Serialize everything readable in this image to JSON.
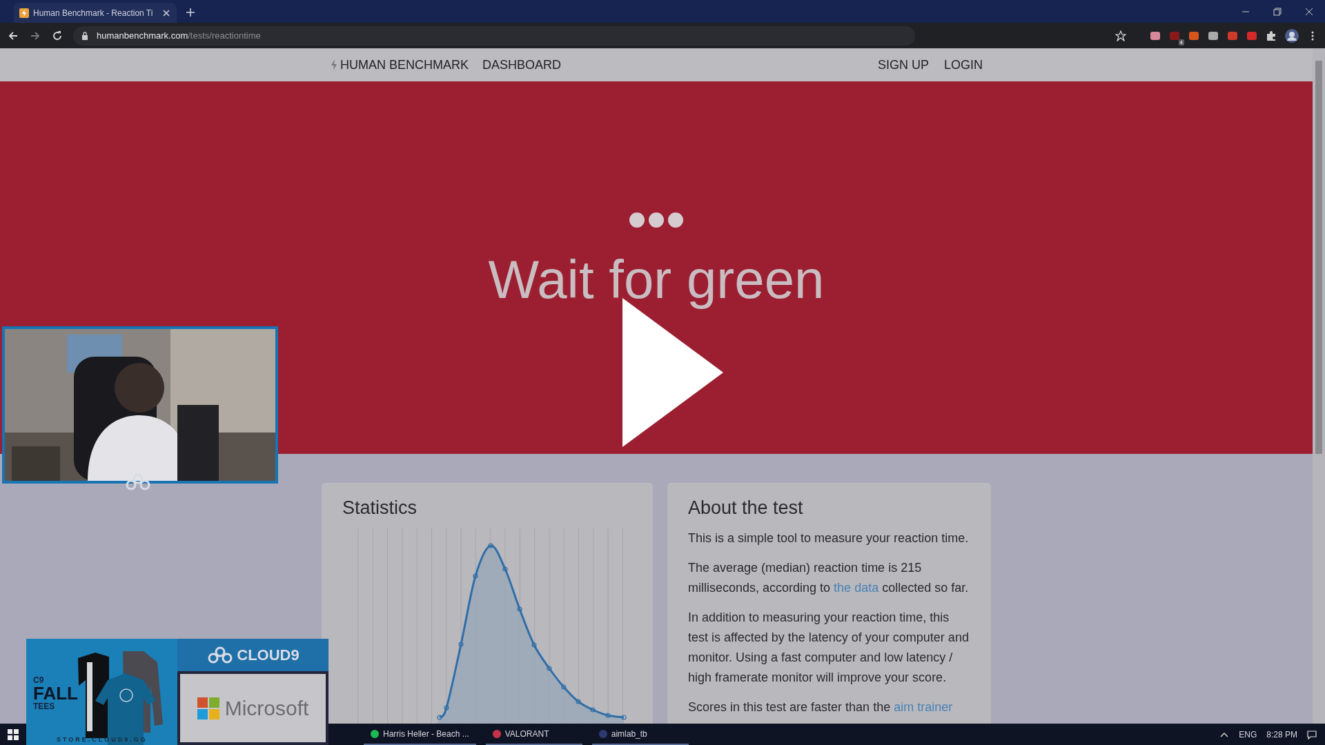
{
  "browser": {
    "tab": {
      "title": "Human Benchmark - Reaction Ti"
    },
    "address": {
      "host": "humanbenchmark.com",
      "path": "/tests/reactiontime"
    },
    "extension_badge": "4"
  },
  "site_nav": {
    "brand": "HUMAN BENCHMARK",
    "links": [
      "DASHBOARD"
    ],
    "account_links": [
      "SIGN UP",
      "LOGIN"
    ]
  },
  "hero": {
    "message": "Wait for green"
  },
  "statistics": {
    "title": "Statistics"
  },
  "about": {
    "title": "About the test",
    "paragraphs": [
      [
        {
          "kind": "text",
          "text": "This is a simple tool to measure your reaction time."
        }
      ],
      [
        {
          "kind": "text",
          "text": "The average (median) reaction time is 215 milliseconds, according to "
        },
        {
          "kind": "link",
          "text": "the data"
        },
        {
          "kind": "text",
          "text": " collected so far."
        }
      ],
      [
        {
          "kind": "text",
          "text": "In addition to measuring your reaction time, this test is affected by the latency of your computer and monitor. Using a fast computer and low latency / high framerate monitor will improve your score."
        }
      ],
      [
        {
          "kind": "text",
          "text": "Scores in this test are faster than the "
        },
        {
          "kind": "link",
          "text": "aim trainer"
        }
      ]
    ]
  },
  "stream_overlay": {
    "ad": {
      "kicker": "C9",
      "headline": "FALL",
      "subhead": "TEES",
      "store_url": "STORE.CLOUD9.GG",
      "team": "CLOUD9",
      "sponsor": "Microsoft"
    }
  },
  "taskbar": {
    "apps": [
      {
        "label": "Harris Heller - Beach ...",
        "color": "#1db954"
      },
      {
        "label": "VALORANT",
        "color": "#c8324a"
      },
      {
        "label": "aimlab_tb",
        "color": "#2c3a6e"
      }
    ],
    "language": "ENG",
    "time": "8:28 PM"
  }
}
